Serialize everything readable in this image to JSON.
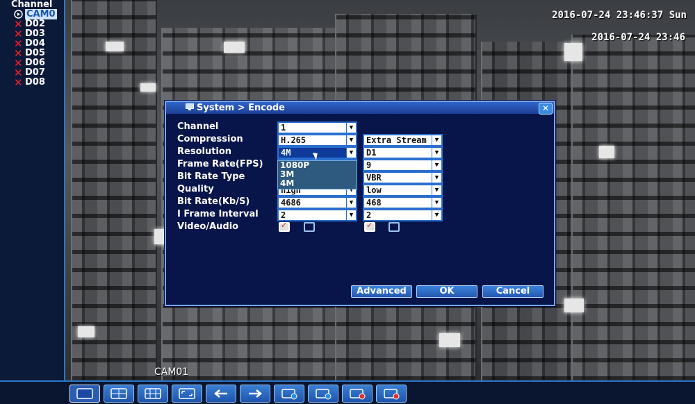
{
  "sidebar": {
    "title": "Channel",
    "channels": [
      {
        "label": "CAM0",
        "active": true
      },
      {
        "label": "D02",
        "active": false
      },
      {
        "label": "D03",
        "active": false
      },
      {
        "label": "D04",
        "active": false
      },
      {
        "label": "D05",
        "active": false
      },
      {
        "label": "D06",
        "active": false
      },
      {
        "label": "D07",
        "active": false
      },
      {
        "label": "D08",
        "active": false
      }
    ]
  },
  "feed": {
    "timestamp_top": "2016-07-24 23:46:37 Sun",
    "timestamp_osd": "2016-07-24 23:46",
    "camera_name": "CAM01"
  },
  "dialog": {
    "title": "System > Encode",
    "rows": {
      "channel": {
        "label": "Channel",
        "main": "1"
      },
      "compression": {
        "label": "Compression",
        "main": "H.265",
        "extra": "Extra Stream"
      },
      "resolution": {
        "label": "Resolution",
        "main": "4M",
        "extra": "D1"
      },
      "frame_rate": {
        "label": "Frame Rate(FPS)",
        "main": "",
        "extra": "9"
      },
      "bit_rate_type": {
        "label": "Bit Rate Type",
        "main": "",
        "extra": "VBR"
      },
      "quality": {
        "label": "Quality",
        "main": "high",
        "extra": "low"
      },
      "bit_rate": {
        "label": "Bit Rate(Kb/S)",
        "main": "4686",
        "extra": "468"
      },
      "i_frame": {
        "label": "I Frame Interval",
        "main": "2",
        "extra": "2"
      },
      "video_audio": {
        "label": "Video/Audio"
      }
    },
    "resolution_dropdown": [
      "1080P",
      "3M",
      "4M"
    ],
    "buttons": {
      "advanced": "Advanced",
      "ok": "OK",
      "cancel": "Cancel"
    }
  },
  "colors": {
    "panel": "#08154a",
    "accent": "#2a78c8",
    "close_red": "#ff2020"
  }
}
